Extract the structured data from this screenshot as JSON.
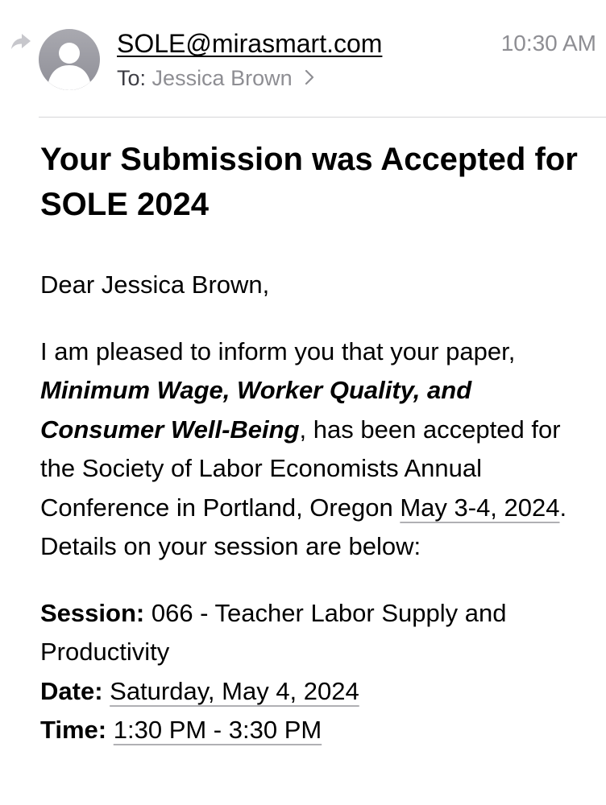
{
  "header": {
    "sender": "SOLE@mirasmart.com",
    "time": "10:30 AM",
    "to_label": "To:",
    "to_name": "Jessica Brown"
  },
  "subject": "Your Submission was Accepted for SOLE 2024",
  "body": {
    "greeting": "Dear Jessica Brown,",
    "intro_1": "I am pleased to inform you that your paper, ",
    "paper_title": "Minimum Wage, Worker Quality, and Consumer Well-Being",
    "intro_2": ", has been accepted for the Society of Labor Economists Annual Conference in Portland, Oregon ",
    "conference_dates": "May 3-4, 2024",
    "intro_3": ". Details on your session are below:",
    "session_label": "Session:",
    "session_value": " 066 - Teacher Labor Supply and Productivity",
    "date_label": "Date:",
    "date_value": "Saturday, May 4, 2024",
    "time_label": "Time:",
    "time_value": "1:30 PM - 3:30 PM"
  },
  "icons": {
    "forward": "forward-arrow-icon",
    "avatar": "person-avatar-icon",
    "chevron": "chevron-right-icon"
  },
  "colors": {
    "secondary_text": "#8e8e93",
    "avatar_gray": "#9d9da4",
    "divider": "#d6d6d8"
  }
}
